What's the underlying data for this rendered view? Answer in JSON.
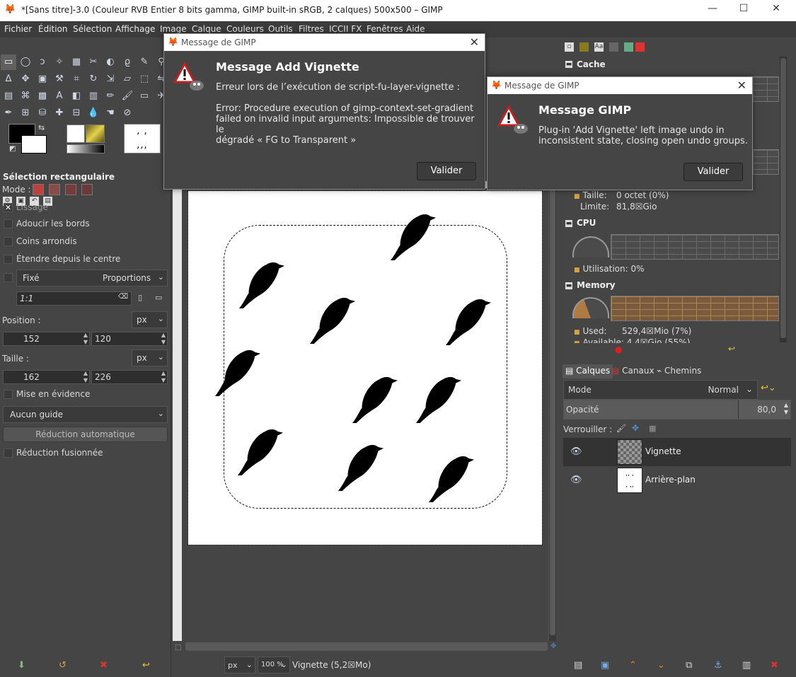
{
  "window": {
    "title": "*[Sans titre]-3.0 (Couleur RVB Entier 8 bits gamma, GIMP built-in sRGB, 2 calques) 500x500 – GIMP",
    "minimize": "—",
    "maximize": "☐",
    "close": "✕"
  },
  "menu": [
    "Fichier",
    "Édition",
    "Sélection",
    "Affichage",
    "Image",
    "Calque",
    "Couleurs",
    "Outils",
    "Filtres",
    "ICCII FX",
    "Fenêtres",
    "Aide"
  ],
  "tool_options": {
    "title": "Sélection rectangulaire",
    "mode_label": "Mode :",
    "antialias": "Lissage",
    "feather": "Adoucir les bords",
    "rounded": "Coins arrondis",
    "expand_center": "Étendre depuis le centre",
    "fixed": "Fixé",
    "fixed_value": "Proportions",
    "ratio": "1:1",
    "position_label": "Position :",
    "position_unit": "px",
    "position_x": "152",
    "position_y": "120",
    "size_label": "Taille :",
    "size_unit": "px",
    "size_w": "162",
    "size_h": "226",
    "highlight": "Mise en évidence",
    "guide": "Aucun guide",
    "autoshrink": "Réduction automatique",
    "shrink_merged": "Réduction fusionnée"
  },
  "status": {
    "unit": "px",
    "zoom": "100 %",
    "text": "Vignette (5,2☒Mo)"
  },
  "dashboard": {
    "cache_title": "Cache",
    "swap_size_label": "Taille:",
    "swap_size_val": "0 octet (0%)",
    "swap_limit_label": "Limite:",
    "swap_limit_val": "81,8☒Gio",
    "cpu_title": "CPU",
    "cpu_usage_label": "Utilisation:",
    "cpu_usage_val": "0%",
    "memory_title": "Memory",
    "mem_used_label": "Used:",
    "mem_used_val": "529,4☒Mio (7%)",
    "mem_avail_label": "Available:",
    "mem_avail_val": "4,4☒Gio (55%)"
  },
  "layers_panel": {
    "tabs": [
      "Calques",
      "Canaux",
      "Chemins"
    ],
    "mode_label": "Mode",
    "mode_value": "Normal",
    "opacity_label": "Opacité",
    "opacity_value": "80,0",
    "lock_label": "Verrouiller :",
    "layers": [
      {
        "name": "Vignette",
        "selected": true
      },
      {
        "name": "Arrière-plan",
        "selected": false
      }
    ]
  },
  "dialog_vignette": {
    "window_title": "Message de GIMP",
    "heading": "Message Add Vignette",
    "body": "Erreur lors de l’exécution de script-fu-layer-vignette :\n\nError: Procedure execution of gimp-context-set-gradient\nfailed on invalid input arguments: Impossible de trouver le\ndégradé « FG to Transparent »",
    "button": "Valider"
  },
  "dialog_gimp": {
    "window_title": "Message de GIMP",
    "heading": "Message GIMP",
    "body": "Plug-in 'Add Vignette' left image undo in\ninconsistent state, closing open undo groups.",
    "button": "Valider"
  },
  "colors": {
    "accent_memory": "#b07a44",
    "foreground": "#000000",
    "background": "#ffffff"
  }
}
